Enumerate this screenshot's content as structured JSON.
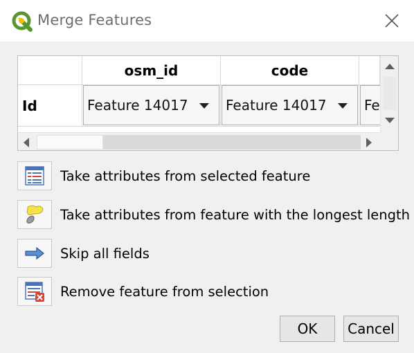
{
  "window": {
    "title": "Merge Features",
    "icons": {
      "app": "qgis-logo-icon",
      "close": "close-icon"
    }
  },
  "table": {
    "corner_label": "",
    "columns": [
      "osm_id",
      "code",
      ""
    ],
    "rows": [
      {
        "header": "Id",
        "cells": [
          "Feature 14017",
          "Feature 14017",
          "Fe"
        ]
      }
    ]
  },
  "actions": [
    {
      "label": "Take attributes from selected feature",
      "icon": "attribute-table-icon"
    },
    {
      "label": "Take attributes from feature with the longest length",
      "icon": "longest-feature-icon"
    },
    {
      "label": "Skip all fields",
      "icon": "arrow-right-icon"
    },
    {
      "label": "Remove feature from selection",
      "icon": "remove-from-selection-icon"
    }
  ],
  "buttons": {
    "ok": "OK",
    "cancel": "Cancel"
  },
  "colors": {
    "accent_green": "#589632",
    "accent_yellow": "#f0c200",
    "icon_blue": "#4b74b8",
    "icon_red": "#d9443a"
  }
}
